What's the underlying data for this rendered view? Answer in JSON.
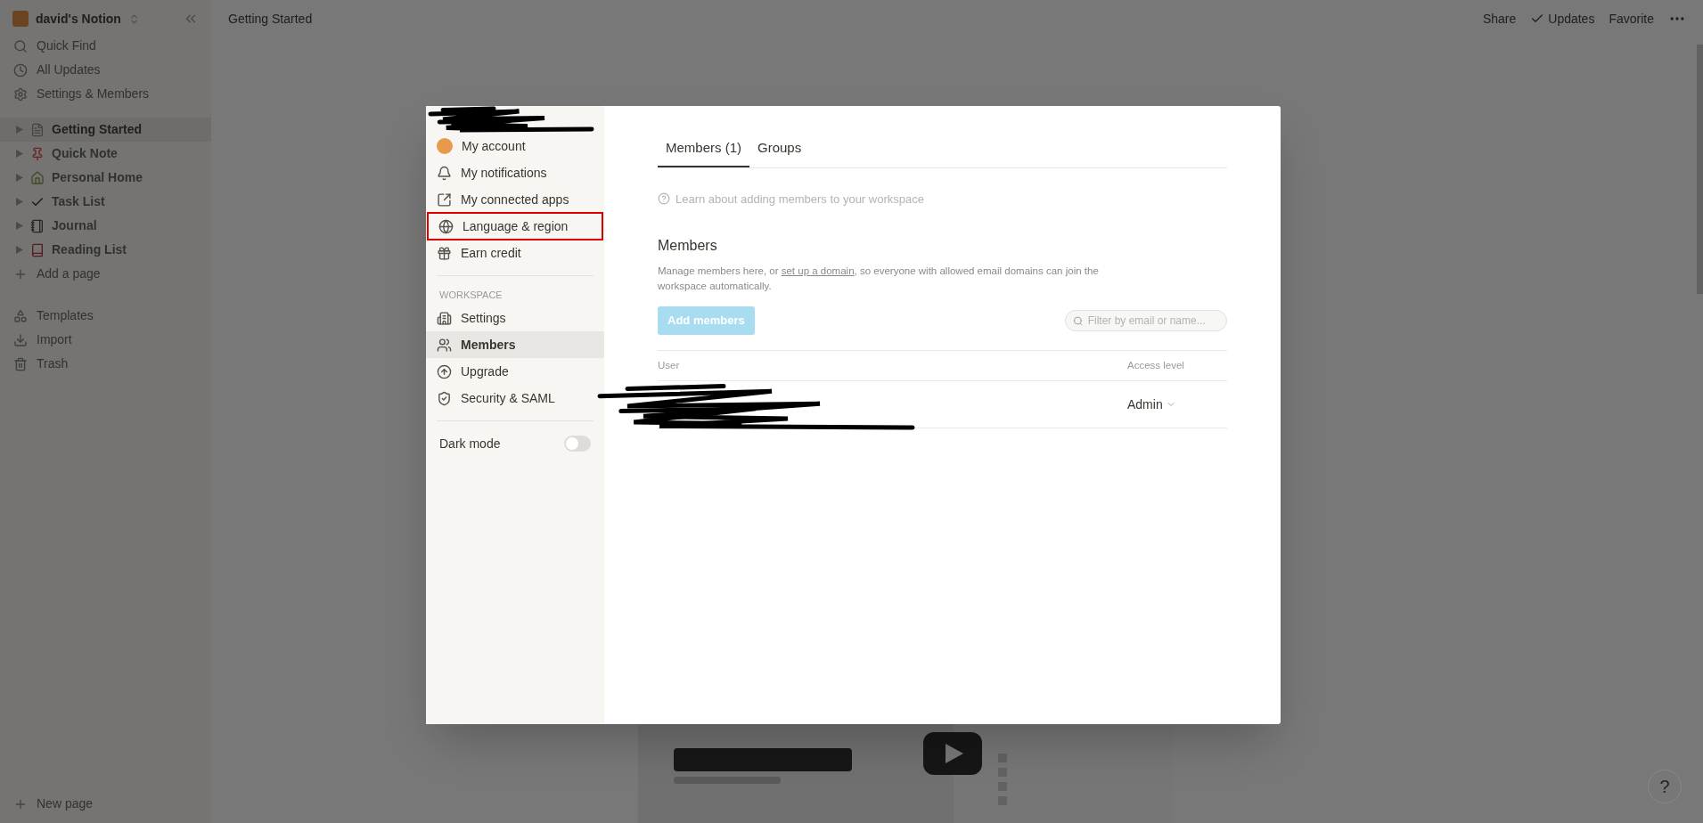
{
  "workspace": {
    "name": "david's Notion"
  },
  "sidebar": {
    "top_items": [
      {
        "label": "Quick Find",
        "kind": "search"
      },
      {
        "label": "All Updates",
        "kind": "clock"
      },
      {
        "label": "Settings & Members",
        "kind": "gear"
      }
    ],
    "pages": [
      {
        "label": "Getting Started",
        "kind": "doc",
        "selected": true
      },
      {
        "label": "Quick Note",
        "kind": "pin",
        "selected": false
      },
      {
        "label": "Personal Home",
        "kind": "house",
        "selected": false
      },
      {
        "label": "Task List",
        "kind": "check",
        "selected": false
      },
      {
        "label": "Journal",
        "kind": "notebook",
        "selected": false
      },
      {
        "label": "Reading List",
        "kind": "book",
        "selected": false
      }
    ],
    "add_page": "Add a page",
    "bottom_items": [
      {
        "label": "Templates",
        "kind": "shapes"
      },
      {
        "label": "Import",
        "kind": "import"
      },
      {
        "label": "Trash",
        "kind": "trash"
      }
    ],
    "new_page": "New page"
  },
  "topbar": {
    "breadcrumb": "Getting Started",
    "actions": [
      {
        "label": "Share",
        "kind": "plain"
      },
      {
        "label": "Updates",
        "kind": "check"
      },
      {
        "label": "Favorite",
        "kind": "plain"
      }
    ]
  },
  "settings": {
    "account_nav": [
      {
        "label": "My account",
        "kind": "avatar",
        "selected": false,
        "highlighted": false
      },
      {
        "label": "My notifications",
        "kind": "bell",
        "selected": false,
        "highlighted": false
      },
      {
        "label": "My connected apps",
        "kind": "link",
        "selected": false,
        "highlighted": false
      },
      {
        "label": "Language & region",
        "kind": "globe",
        "selected": false,
        "highlighted": true
      },
      {
        "label": "Earn credit",
        "kind": "gift",
        "selected": false,
        "highlighted": false
      }
    ],
    "workspace_label": "WORKSPACE",
    "workspace_nav": [
      {
        "label": "Settings",
        "kind": "building",
        "selected": false,
        "highlighted": false
      },
      {
        "label": "Members",
        "kind": "users",
        "selected": true,
        "highlighted": false
      },
      {
        "label": "Upgrade",
        "kind": "upgrade",
        "selected": false,
        "highlighted": false
      },
      {
        "label": "Security & SAML",
        "kind": "shield",
        "selected": false,
        "highlighted": false
      }
    ],
    "dark_mode": {
      "label": "Dark mode",
      "on": false
    },
    "tabs": [
      {
        "label": "Members (1)",
        "selected": true
      },
      {
        "label": "Groups",
        "selected": false
      }
    ],
    "help_link": "Learn about adding members to your workspace",
    "members_heading": "Members",
    "description": {
      "before": "Manage members here, or ",
      "link": "set up a domain",
      "after": ", so everyone with allowed email domains can join the workspace automatically."
    },
    "add_button": {
      "label": "Add members",
      "disabled": true
    },
    "filter": {
      "placeholder": "Filter by email or name..."
    },
    "table": {
      "columns": [
        "User",
        "Access level"
      ],
      "rows": [
        {
          "access": "Admin"
        }
      ]
    }
  },
  "help_button": "?"
}
